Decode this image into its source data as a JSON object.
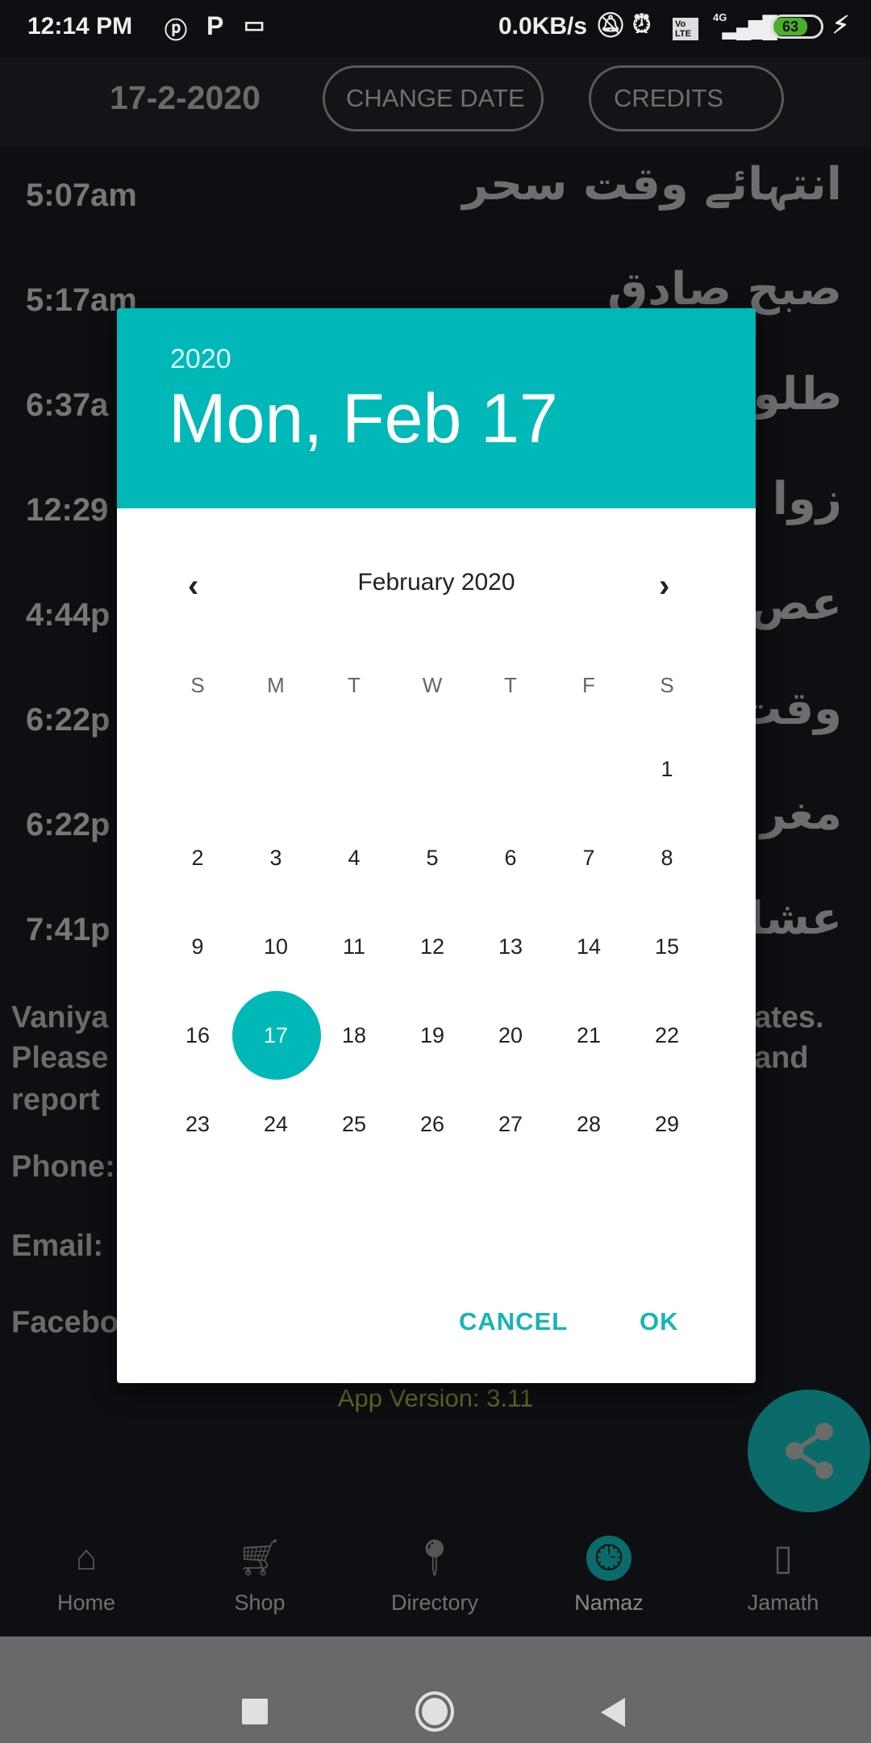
{
  "status_bar": {
    "time": "12:14 PM",
    "net_speed": "0.0KB/s",
    "network": "4G",
    "volte": "Vo LTE",
    "battery": "63"
  },
  "header": {
    "date": "17-2-2020",
    "change_date_label": "CHANGE DATE",
    "credits_label": "CREDITS"
  },
  "prayer_times": [
    {
      "time": "5:07am",
      "name": "انتہائے وقت سحر"
    },
    {
      "time": "5:17am",
      "name": "صبح صادق"
    },
    {
      "time": "6:37a",
      "name": "طلو"
    },
    {
      "time": "12:29",
      "name": "زوا"
    },
    {
      "time": "4:44p",
      "name": "عص"
    },
    {
      "time": "6:22p",
      "name": "وقت"
    },
    {
      "time": "6:22p",
      "name": "مغر"
    },
    {
      "time": "7:41p",
      "name": "عشا"
    }
  ],
  "info": {
    "line1_left": "Vaniya",
    "line1_right": "ates.",
    "line2_left": "Please",
    "line2_right": "and",
    "line3": "report",
    "phone": "Phone:",
    "email": "Email:",
    "facebook": "Facebo",
    "version": "App Version: 3.11"
  },
  "dialog": {
    "year": "2020",
    "date": "Mon, Feb 17",
    "month": "February 2020",
    "weekdays": [
      "S",
      "M",
      "T",
      "W",
      "T",
      "F",
      "S"
    ],
    "first_weekday": 6,
    "days_in_month": 29,
    "selected_day": 17,
    "cancel": "CANCEL",
    "ok": "OK",
    "accent": "#00b8b8"
  },
  "bottom_nav": {
    "items": [
      {
        "label": "Home",
        "icon": "home-icon"
      },
      {
        "label": "Shop",
        "icon": "cart-icon"
      },
      {
        "label": "Directory",
        "icon": "location-pin-icon"
      },
      {
        "label": "Namaz",
        "icon": "clock-icon",
        "active": true
      },
      {
        "label": "Jamath",
        "icon": "jamath-icon"
      }
    ]
  },
  "fab": {
    "icon": "share-icon"
  }
}
